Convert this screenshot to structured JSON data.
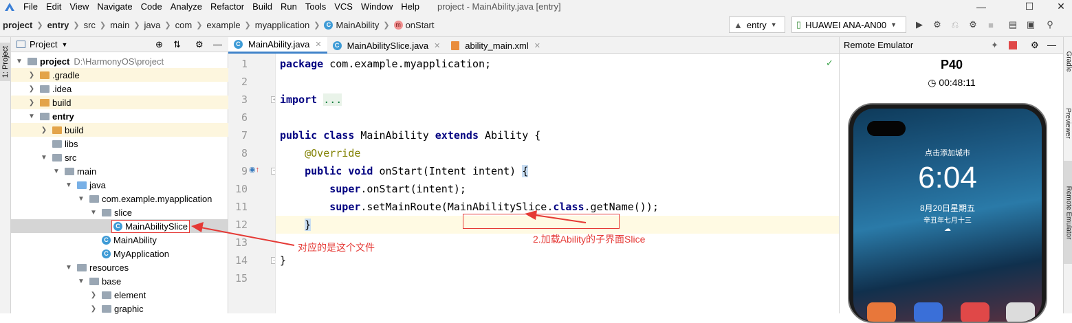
{
  "menubar": {
    "items": [
      "File",
      "Edit",
      "View",
      "Navigate",
      "Code",
      "Analyze",
      "Refactor",
      "Build",
      "Run",
      "Tools",
      "VCS",
      "Window",
      "Help"
    ],
    "window_title": "project - MainAbility.java [entry]"
  },
  "breadcrumb": {
    "items": [
      "project",
      "entry",
      "src",
      "main",
      "java",
      "com",
      "example",
      "myapplication",
      "MainAbility",
      "onStart"
    ]
  },
  "toolbar": {
    "module_combo": "entry",
    "device_combo": "HUAWEI ANA-AN00"
  },
  "left_strip": {
    "project_tab": "1: Project"
  },
  "project_panel": {
    "title": "Project",
    "tree": [
      {
        "label": "project",
        "path": "D:\\HarmonyOS\\project"
      },
      {
        "label": ".gradle"
      },
      {
        "label": ".idea"
      },
      {
        "label": "build"
      },
      {
        "label": "entry"
      },
      {
        "label": "build"
      },
      {
        "label": "libs"
      },
      {
        "label": "src"
      },
      {
        "label": "main"
      },
      {
        "label": "java"
      },
      {
        "label": "com.example.myapplication"
      },
      {
        "label": "slice"
      },
      {
        "label": "MainAbilitySlice"
      },
      {
        "label": "MainAbility"
      },
      {
        "label": "MyApplication"
      },
      {
        "label": "resources"
      },
      {
        "label": "base"
      },
      {
        "label": "element"
      },
      {
        "label": "graphic"
      }
    ]
  },
  "editor": {
    "tabs": [
      "MainAbility.java",
      "MainAbilitySlice.java",
      "ability_main.xml"
    ],
    "line_numbers": [
      "1",
      "2",
      "3",
      "6",
      "7",
      "8",
      "9",
      "10",
      "11",
      "12",
      "13",
      "14",
      "15"
    ],
    "code": {
      "l1_kw": "package",
      "l1_rest": " com.example.myapplication;",
      "l3_kw": "import",
      "l3_fold": "...",
      "l7_kw1": "public",
      "l7_kw2": "class",
      "l7_name": " MainAbility ",
      "l7_kw3": "extends",
      "l7_rest": " Ability {",
      "l8_an": "@Override",
      "l9_kw1": "public",
      "l9_kw2": "void",
      "l9_rest": " onStart(Intent intent) ",
      "l9_brace": "{",
      "l10_kw": "super",
      "l10_rest": ".onStart(intent);",
      "l11_kw": "super",
      "l11_pre": ".setMainRoute(",
      "l11_cls": "MainAbilitySlice.",
      "l11_kw2": "class",
      "l11_post": ".getName());",
      "l12_brace": "}",
      "l14": "}"
    }
  },
  "annotations": {
    "file_note": "对应的是这个文件",
    "slice_note": "2.加载Ability的子界面Slice"
  },
  "remote_emulator": {
    "title": "Remote Emulator",
    "device": "P40",
    "timer": "00:48:11",
    "lock_hint": "点击添加城市",
    "time": "6:04",
    "date": "8月20日星期五",
    "lunar": "辛丑年七月十三"
  },
  "right_strip": {
    "gradle": "Gradle",
    "previewer": "Previewer",
    "remote_emulator": "Remote Emulator"
  },
  "colors": {
    "accent": "#4083c9",
    "annotation": "#e53935",
    "keyword": "#000080",
    "annotation_code": "#808000"
  }
}
